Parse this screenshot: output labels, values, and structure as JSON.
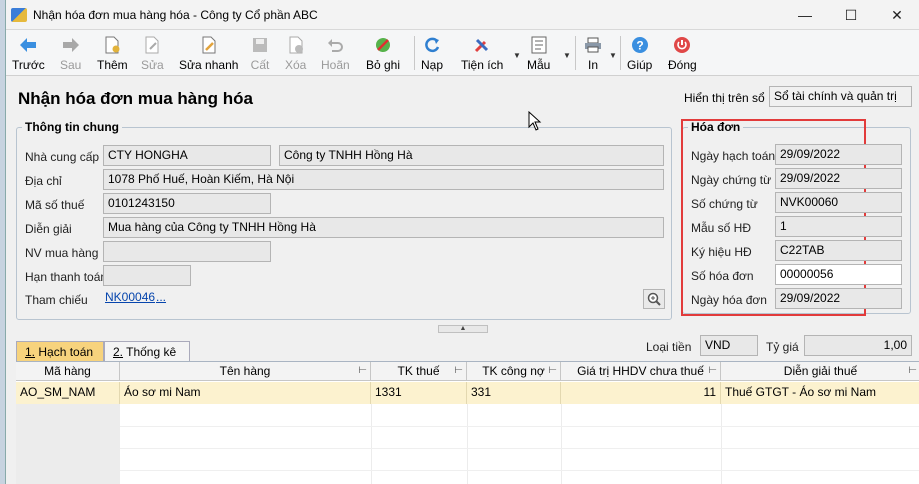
{
  "window": {
    "title": "Nhận hóa đơn mua hàng hóa - Công ty Cổ phần ABC"
  },
  "toolbar": {
    "buttons": [
      {
        "label": "Trước",
        "icon": "arrow-left-icon",
        "enabled": true
      },
      {
        "label": "Sau",
        "icon": "arrow-right-icon",
        "enabled": false
      },
      {
        "label": "Thêm",
        "icon": "new-document-icon",
        "enabled": true
      },
      {
        "label": "Sửa",
        "icon": "edit-document-icon",
        "enabled": false
      },
      {
        "label": "Sửa nhanh",
        "icon": "quick-edit-icon",
        "enabled": true
      },
      {
        "label": "Cất",
        "icon": "save-icon",
        "enabled": false
      },
      {
        "label": "Xóa",
        "icon": "delete-icon",
        "enabled": false
      },
      {
        "label": "Hoãn",
        "icon": "undo-icon",
        "enabled": false
      },
      {
        "label": "Bỏ ghi",
        "icon": "unpost-icon",
        "enabled": true
      },
      {
        "label": "Nạp",
        "icon": "refresh-icon",
        "enabled": true
      },
      {
        "label": "Tiện ích",
        "icon": "tools-icon",
        "enabled": true
      },
      {
        "label": "Mẫu",
        "icon": "template-icon",
        "enabled": true
      },
      {
        "label": "In",
        "icon": "print-icon",
        "enabled": true
      },
      {
        "label": "Giúp",
        "icon": "help-icon",
        "enabled": true
      },
      {
        "label": "Đóng",
        "icon": "power-icon",
        "enabled": true
      }
    ]
  },
  "form": {
    "title": "Nhận hóa đơn mua hàng hóa",
    "display_label": "Hiển thị trên sổ",
    "display_value": "Sổ tài chính và quản trị"
  },
  "general_info": {
    "title": "Thông tin chung",
    "supplier_label": "Nhà cung cấp",
    "supplier_code": "CTY HONGHA",
    "supplier_name": "Công ty TNHH Hồng Hà",
    "address_label": "Địa chỉ",
    "address": "1078 Phố Huế, Hoàn Kiếm, Hà Nội",
    "tax_code_label": "Mã số thuế",
    "tax_code": "0101243150",
    "description_label": "Diễn giải",
    "description": "Mua hàng của Công ty TNHH Hồng Hà",
    "purchaser_label": "NV mua hàng",
    "purchaser": "",
    "due_label": "Hạn thanh toán",
    "due": "",
    "reference_label": "Tham chiếu",
    "reference": "NK00046",
    "reference_more": "..."
  },
  "invoice": {
    "title": "Hóa đơn",
    "posting_date_label": "Ngày hạch toán",
    "posting_date": "29/09/2022",
    "voucher_date_label": "Ngày chứng từ",
    "voucher_date": "29/09/2022",
    "voucher_no_label": "Số chứng từ",
    "voucher_no": "NVK00060",
    "form_no_label": "Mẫu số HĐ",
    "form_no": "1",
    "symbol_label": "Ký hiệu HĐ",
    "symbol": "C22TAB",
    "invoice_no_label": "Số hóa đơn",
    "invoice_no": "00000056",
    "invoice_date_label": "Ngày hóa đơn",
    "invoice_date": "29/09/2022"
  },
  "currency": {
    "label": "Loại tiền",
    "value": "VND",
    "rate_label": "Tỷ giá",
    "rate": "1,00"
  },
  "tabs": [
    {
      "num": "1.",
      "label": " Hạch toán"
    },
    {
      "num": "2.",
      "label": " Thống kê"
    }
  ],
  "table": {
    "headers": [
      "Mã hàng",
      "Tên hàng",
      "TK thuế",
      "TK công nợ",
      "Giá trị HHDV chưa thuế",
      "Diễn giải thuế"
    ],
    "rows": [
      [
        "AO_SM_NAM",
        "Áo sơ mi Nam",
        "1331",
        "331",
        "11",
        "Thuế GTGT - Áo sơ mi Nam"
      ]
    ]
  },
  "colors": {
    "accent": "#f7d37d",
    "highlight_border": "#e23b3b",
    "selected_row": "#fcf2cf"
  }
}
